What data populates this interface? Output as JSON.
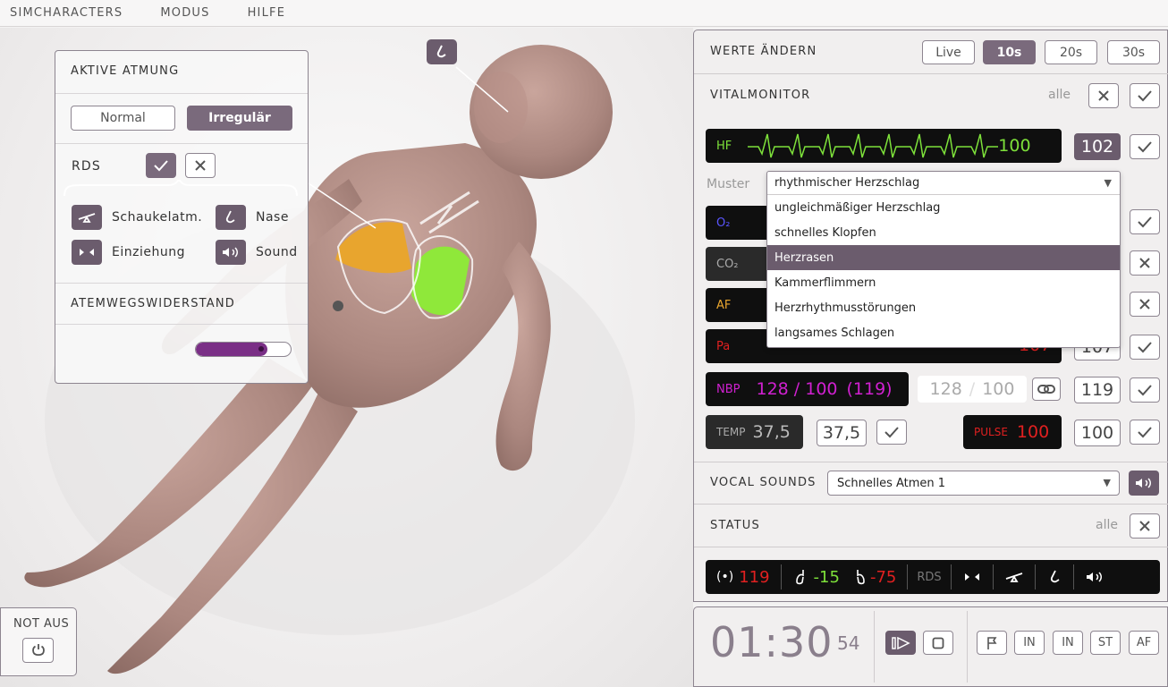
{
  "menu": [
    "SIMCHARACTERS",
    "MODUS",
    "HILFE"
  ],
  "breathing": {
    "title": "AKTIVE ATMUNG",
    "modes": [
      "Normal",
      "Irregulär"
    ],
    "selected_mode": "Irregulär",
    "rds_label": "RDS",
    "options": [
      {
        "label": "Schaukelatm.",
        "icon": "seesaw-icon"
      },
      {
        "label": "Nase",
        "icon": "nose-icon"
      },
      {
        "label": "Einziehung",
        "icon": "retraction-icon"
      },
      {
        "label": "Sound",
        "icon": "sound-icon"
      }
    ],
    "resistance_title": "ATEMWEGSWIDERSTAND",
    "resistance_level": 0.75
  },
  "values": {
    "title": "WERTE ÄNDERN",
    "modes": [
      "Live",
      "10s",
      "20s",
      "30s"
    ],
    "selected_mode": "10s"
  },
  "vital": {
    "title": "VITALMONITOR",
    "all_label": "alle",
    "hf": {
      "label": "HF",
      "value": "100",
      "target": "102",
      "color": "#7de03a"
    },
    "muster_label": "Muster",
    "muster_selected": "rhythmischer Herzschlag",
    "muster_options": [
      "ungleichmäßiger Herzschlag",
      "schnelles Klopfen",
      "Herzrasen",
      "Kammerflimmern",
      "Herzrhythmusstörungen",
      "langsames Schlagen"
    ],
    "muster_highlighted": "Herzrasen",
    "o2_label": "O₂",
    "co2_label": "CO₂",
    "af_label": "AF",
    "pa_label": "Pa",
    "pa_value_partial": "107",
    "pa_target": "107",
    "nbp": {
      "label": "NBP",
      "value": "128 / 100",
      "mean": "(119)",
      "set_sys": "128",
      "set_dia": "100",
      "target": "119"
    },
    "temp": {
      "label": "TEMP",
      "value": "37,5",
      "target": "37,5"
    },
    "pulse": {
      "label": "PULSE",
      "value": "100",
      "target": "100"
    }
  },
  "vocal": {
    "title": "VOCAL SOUNDS",
    "selected": "Schnelles Atmen 1"
  },
  "status": {
    "title": "STATUS",
    "all_label": "alle",
    "hr": "119",
    "lung_left": "-15",
    "lung_right": "-75",
    "rds": "RDS"
  },
  "timer": {
    "time": "01:30",
    "sub": "54",
    "buttons": [
      "IN",
      "IN",
      "ST",
      "AF"
    ]
  },
  "notaus": {
    "label": "NOT AUS"
  }
}
